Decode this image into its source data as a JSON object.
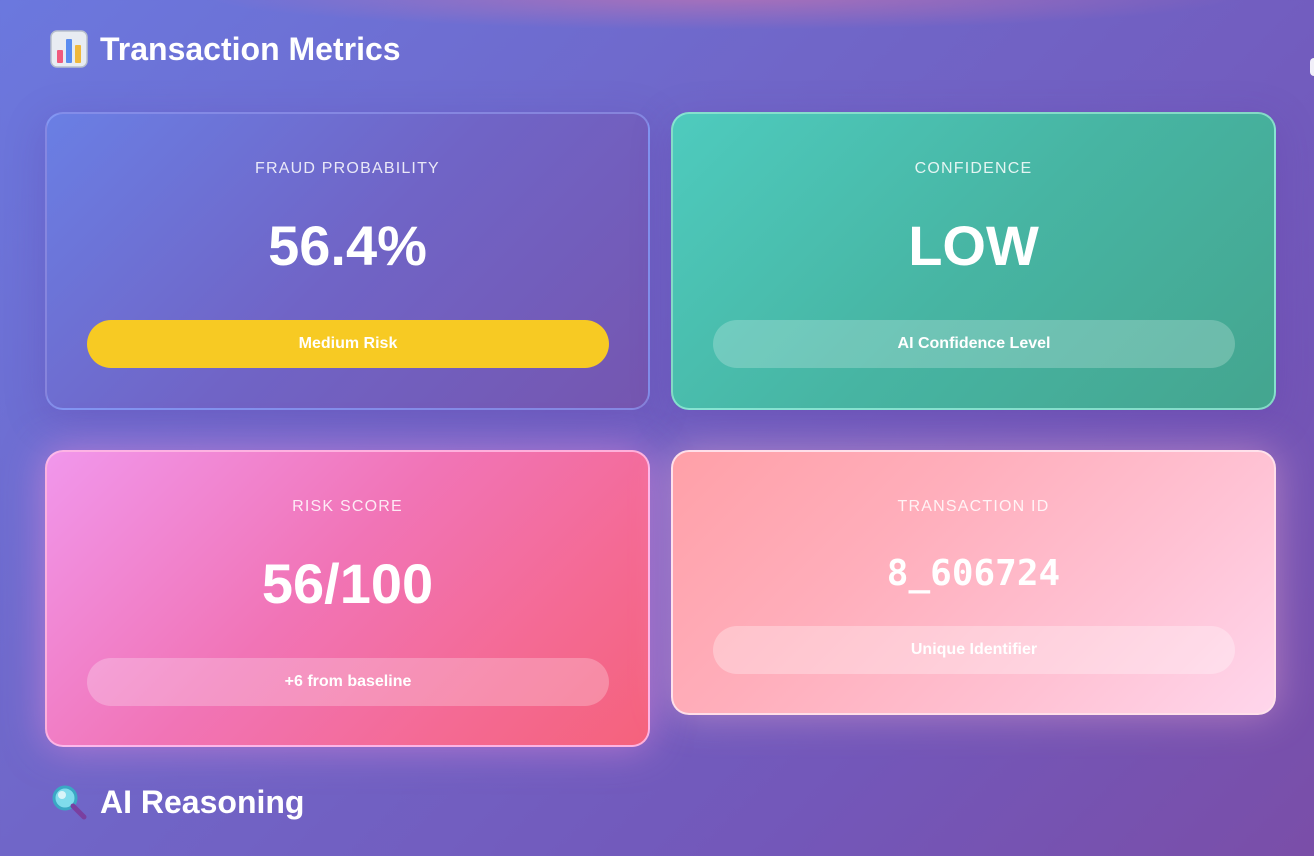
{
  "sections": {
    "metrics_title": "Transaction Metrics",
    "metrics_icon": "bar-chart-icon",
    "reasoning_title": "AI Reasoning",
    "reasoning_icon": "magnifying-glass-icon"
  },
  "cards": {
    "fraud": {
      "label": "FRAUD PROBABILITY",
      "value": "56.4%",
      "pill": "Medium Risk",
      "pill_color": "#f7ca23"
    },
    "confidence": {
      "label": "CONFIDENCE",
      "value": "LOW",
      "pill": "AI Confidence Level"
    },
    "risk": {
      "label": "RISK SCORE",
      "value": "56/100",
      "pill": "+6 from baseline"
    },
    "transaction": {
      "label": "TRANSACTION ID",
      "value": "8_606724",
      "pill": "Unique Identifier"
    }
  },
  "colors": {
    "background": "#7066c8",
    "fraud_card": "#6a7fe4",
    "confidence_card": "#4ecbbe",
    "risk_card": "#f174b6",
    "transaction_card": "#ffaebb"
  }
}
